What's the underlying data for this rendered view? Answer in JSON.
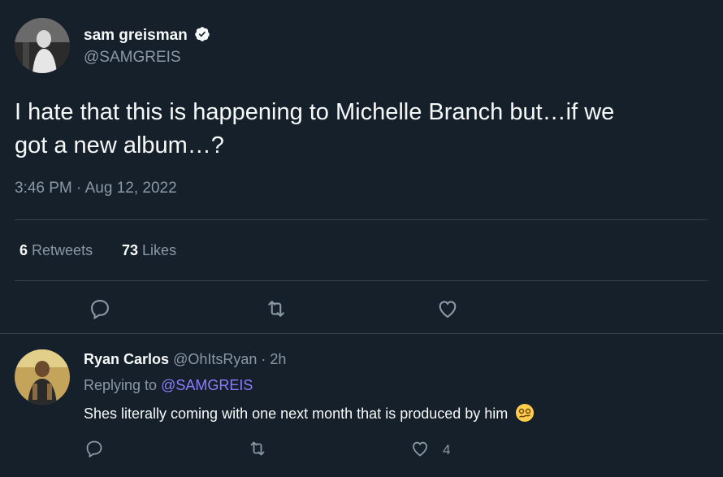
{
  "tweet": {
    "author_name": "sam greisman",
    "author_handle": "@SAMGREIS",
    "text_line1": "I hate that this is happening to Michelle Branch but…if we",
    "text_line2": "got a new album…?",
    "timestamp": "3:46 PM · Aug 12, 2022",
    "retweets_count": "6",
    "retweets_label": "Retweets",
    "likes_count": "73",
    "likes_label": "Likes"
  },
  "reply": {
    "author_name": "Ryan Carlos",
    "author_handle": "@OhItsRyan",
    "time": "· 2h",
    "replying_prefix": "Replying to",
    "replying_handle": "@SAMGREIS",
    "text": "Shes literally coming with one next month that is produced by him",
    "like_count": "4"
  },
  "colors": {
    "background": "#15202b",
    "text": "#f7f9f9",
    "muted": "#8b98a5",
    "link": "#8b7cff",
    "divider": "#38444d"
  },
  "icons": [
    "verified-badge-icon",
    "reply-icon",
    "retweet-icon",
    "like-icon",
    "woozy-face-emoji"
  ]
}
